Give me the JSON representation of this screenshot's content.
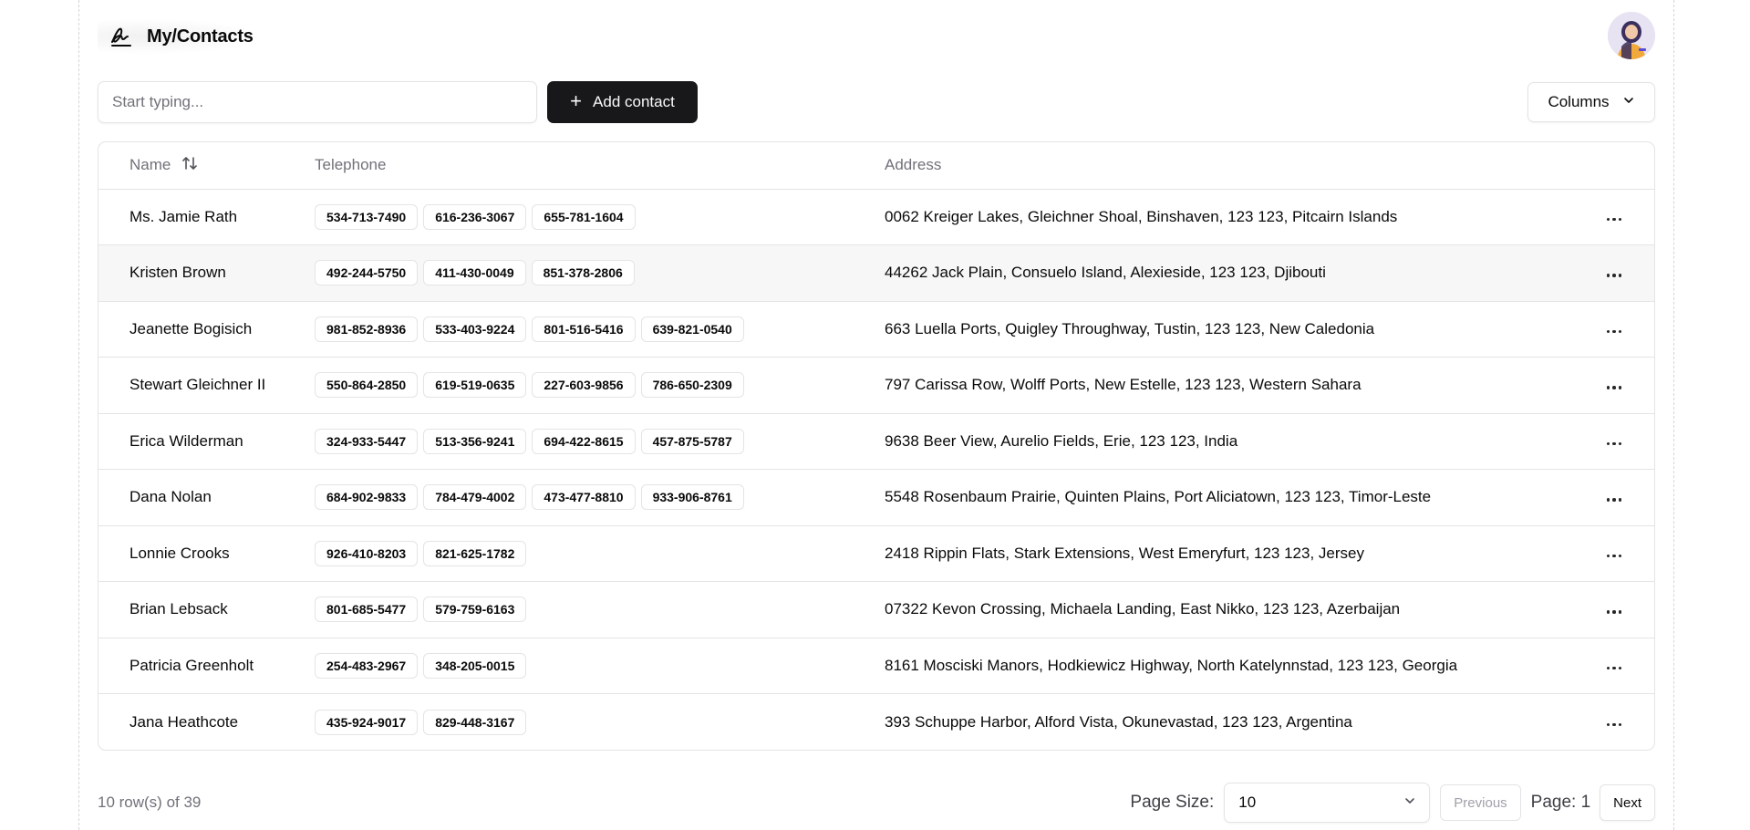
{
  "header": {
    "title": "My/Contacts",
    "logo_icon": "signature-icon",
    "avatar_icon": "user-avatar"
  },
  "toolbar": {
    "search_placeholder": "Start typing...",
    "search_value": "",
    "add_label": "Add contact",
    "columns_label": "Columns"
  },
  "table": {
    "headers": {
      "name": "Name",
      "telephone": "Telephone",
      "address": "Address"
    },
    "rows": [
      {
        "name": "Ms. Jamie Rath",
        "phones": [
          "534-713-7490",
          "616-236-3067",
          "655-781-1604"
        ],
        "address": "0062 Kreiger Lakes, Gleichner Shoal, Binshaven, 123 123, Pitcairn Islands"
      },
      {
        "name": "Kristen Brown",
        "phones": [
          "492-244-5750",
          "411-430-0049",
          "851-378-2806"
        ],
        "address": "44262 Jack Plain, Consuelo Island, Alexieside, 123 123, Djibouti"
      },
      {
        "name": "Jeanette Bogisich",
        "phones": [
          "981-852-8936",
          "533-403-9224",
          "801-516-5416",
          "639-821-0540"
        ],
        "address": "663 Luella Ports, Quigley Throughway, Tustin, 123 123, New Caledonia"
      },
      {
        "name": "Stewart Gleichner II",
        "phones": [
          "550-864-2850",
          "619-519-0635",
          "227-603-9856",
          "786-650-2309"
        ],
        "address": "797 Carissa Row, Wolff Ports, New Estelle, 123 123, Western Sahara"
      },
      {
        "name": "Erica Wilderman",
        "phones": [
          "324-933-5447",
          "513-356-9241",
          "694-422-8615",
          "457-875-5787"
        ],
        "address": "9638 Beer View, Aurelio Fields, Erie, 123 123, India"
      },
      {
        "name": "Dana Nolan",
        "phones": [
          "684-902-9833",
          "784-479-4002",
          "473-477-8810",
          "933-906-8761"
        ],
        "address": "5548 Rosenbaum Prairie, Quinten Plains, Port Aliciatown, 123 123, Timor-Leste"
      },
      {
        "name": "Lonnie Crooks",
        "phones": [
          "926-410-8203",
          "821-625-1782"
        ],
        "address": "2418 Rippin Flats, Stark Extensions, West Emeryfurt, 123 123, Jersey"
      },
      {
        "name": "Brian Lebsack",
        "phones": [
          "801-685-5477",
          "579-759-6163"
        ],
        "address": "07322 Kevon Crossing, Michaela Landing, East Nikko, 123 123, Azerbaijan"
      },
      {
        "name": "Patricia Greenholt",
        "phones": [
          "254-483-2967",
          "348-205-0015"
        ],
        "address": "8161 Mosciski Manors, Hodkiewicz Highway, North Katelynnstad, 123 123, Georgia"
      },
      {
        "name": "Jana Heathcote",
        "phones": [
          "435-924-9017",
          "829-448-3167"
        ],
        "address": "393 Schuppe Harbor, Alford Vista, Okunevastad, 123 123, Argentina"
      }
    ],
    "highlighted_row": 1
  },
  "footer": {
    "row_count": "10 row(s) of 39",
    "page_size_label": "Page Size:",
    "page_size_value": "10",
    "previous_label": "Previous",
    "page_label": "Page: 1",
    "next_label": "Next"
  },
  "colors": {
    "primary_button": "#18181b",
    "border": "#e4e4e7",
    "muted_text": "#71717a",
    "row_highlight": "#f7f7f8"
  }
}
